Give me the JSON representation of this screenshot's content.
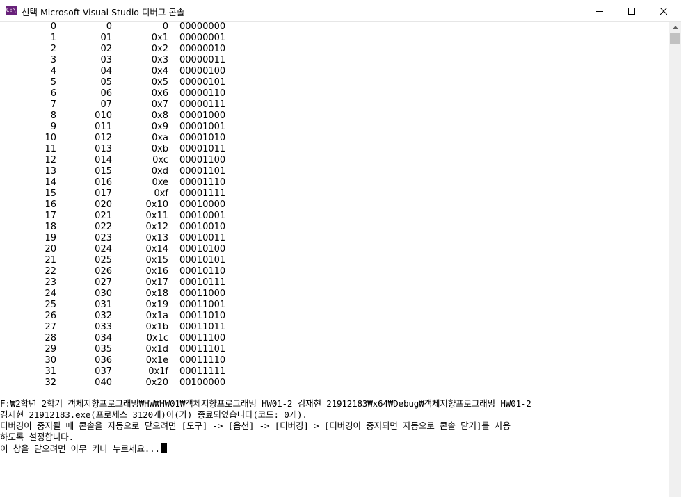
{
  "window": {
    "title": "선택 Microsoft Visual Studio 디버그 콘솔",
    "icon_label": "C:\\",
    "controls": [
      "minimize-icon",
      "maximize-icon",
      "close-icon"
    ]
  },
  "console": {
    "rows": [
      [
        "0",
        "0",
        "0",
        "00000000"
      ],
      [
        "1",
        "01",
        "0x1",
        "00000001"
      ],
      [
        "2",
        "02",
        "0x2",
        "00000010"
      ],
      [
        "3",
        "03",
        "0x3",
        "00000011"
      ],
      [
        "4",
        "04",
        "0x4",
        "00000100"
      ],
      [
        "5",
        "05",
        "0x5",
        "00000101"
      ],
      [
        "6",
        "06",
        "0x6",
        "00000110"
      ],
      [
        "7",
        "07",
        "0x7",
        "00000111"
      ],
      [
        "8",
        "010",
        "0x8",
        "00001000"
      ],
      [
        "9",
        "011",
        "0x9",
        "00001001"
      ],
      [
        "10",
        "012",
        "0xa",
        "00001010"
      ],
      [
        "11",
        "013",
        "0xb",
        "00001011"
      ],
      [
        "12",
        "014",
        "0xc",
        "00001100"
      ],
      [
        "13",
        "015",
        "0xd",
        "00001101"
      ],
      [
        "14",
        "016",
        "0xe",
        "00001110"
      ],
      [
        "15",
        "017",
        "0xf",
        "00001111"
      ],
      [
        "16",
        "020",
        "0x10",
        "00010000"
      ],
      [
        "17",
        "021",
        "0x11",
        "00010001"
      ],
      [
        "18",
        "022",
        "0x12",
        "00010010"
      ],
      [
        "19",
        "023",
        "0x13",
        "00010011"
      ],
      [
        "20",
        "024",
        "0x14",
        "00010100"
      ],
      [
        "21",
        "025",
        "0x15",
        "00010101"
      ],
      [
        "22",
        "026",
        "0x16",
        "00010110"
      ],
      [
        "23",
        "027",
        "0x17",
        "00010111"
      ],
      [
        "24",
        "030",
        "0x18",
        "00011000"
      ],
      [
        "25",
        "031",
        "0x19",
        "00011001"
      ],
      [
        "26",
        "032",
        "0x1a",
        "00011010"
      ],
      [
        "27",
        "033",
        "0x1b",
        "00011011"
      ],
      [
        "28",
        "034",
        "0x1c",
        "00011100"
      ],
      [
        "29",
        "035",
        "0x1d",
        "00011101"
      ],
      [
        "30",
        "036",
        "0x1e",
        "00011110"
      ],
      [
        "31",
        "037",
        "0x1f",
        "00011111"
      ],
      [
        "32",
        "040",
        "0x20",
        "00100000"
      ]
    ],
    "messages": [
      "F:₩2학년 2학기 객체지향프로그래밍₩HW₩HW01₩객체지향프로그래밍 HW01-2 김재현 21912183₩x64₩Debug₩객체지향프로그래밍 HW01-2",
      "김재현 21912183.exe(프로세스 3120개)이(가) 종료되었습니다(코드: 0개).",
      "디버깅이 중지될 때 콘솔을 자동으로 닫으려면 [도구] -> [옵션] -> [디버깅] > [디버깅이 중지되면 자동으로 콘솔 닫기]를 사용",
      "하도록 설정합니다.",
      "이 창을 닫으려면 아무 키나 누르세요..."
    ]
  },
  "colors": {
    "console_bg": "#ffffff",
    "console_text": "#000000",
    "icon_bg": "#68217a",
    "scrollbar_bg": "#f0f0f0",
    "scrollbar_thumb": "#c1c1c1"
  }
}
